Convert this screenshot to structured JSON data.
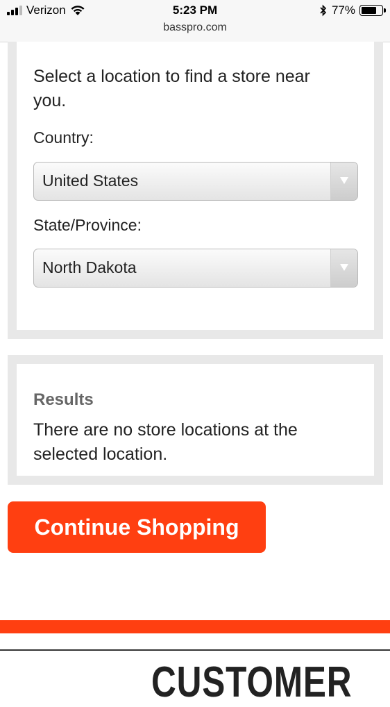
{
  "status_bar": {
    "carrier": "Verizon",
    "time": "5:23 PM",
    "url": "basspro.com",
    "battery_percent": "77%",
    "battery_level": 0.77
  },
  "locator": {
    "intro": "Select a location to find a store near you.",
    "country_label": "Country:",
    "country_value": "United States",
    "state_label": "State/Province:",
    "state_value": "North Dakota"
  },
  "results": {
    "title": "Results",
    "message": "There are no store locations at the selected location."
  },
  "cta": {
    "label": "Continue Shopping"
  },
  "footer": {
    "heading": "CUSTOMER"
  },
  "colors": {
    "accent": "#ff3f11",
    "panel_border": "#e8e8e8"
  }
}
